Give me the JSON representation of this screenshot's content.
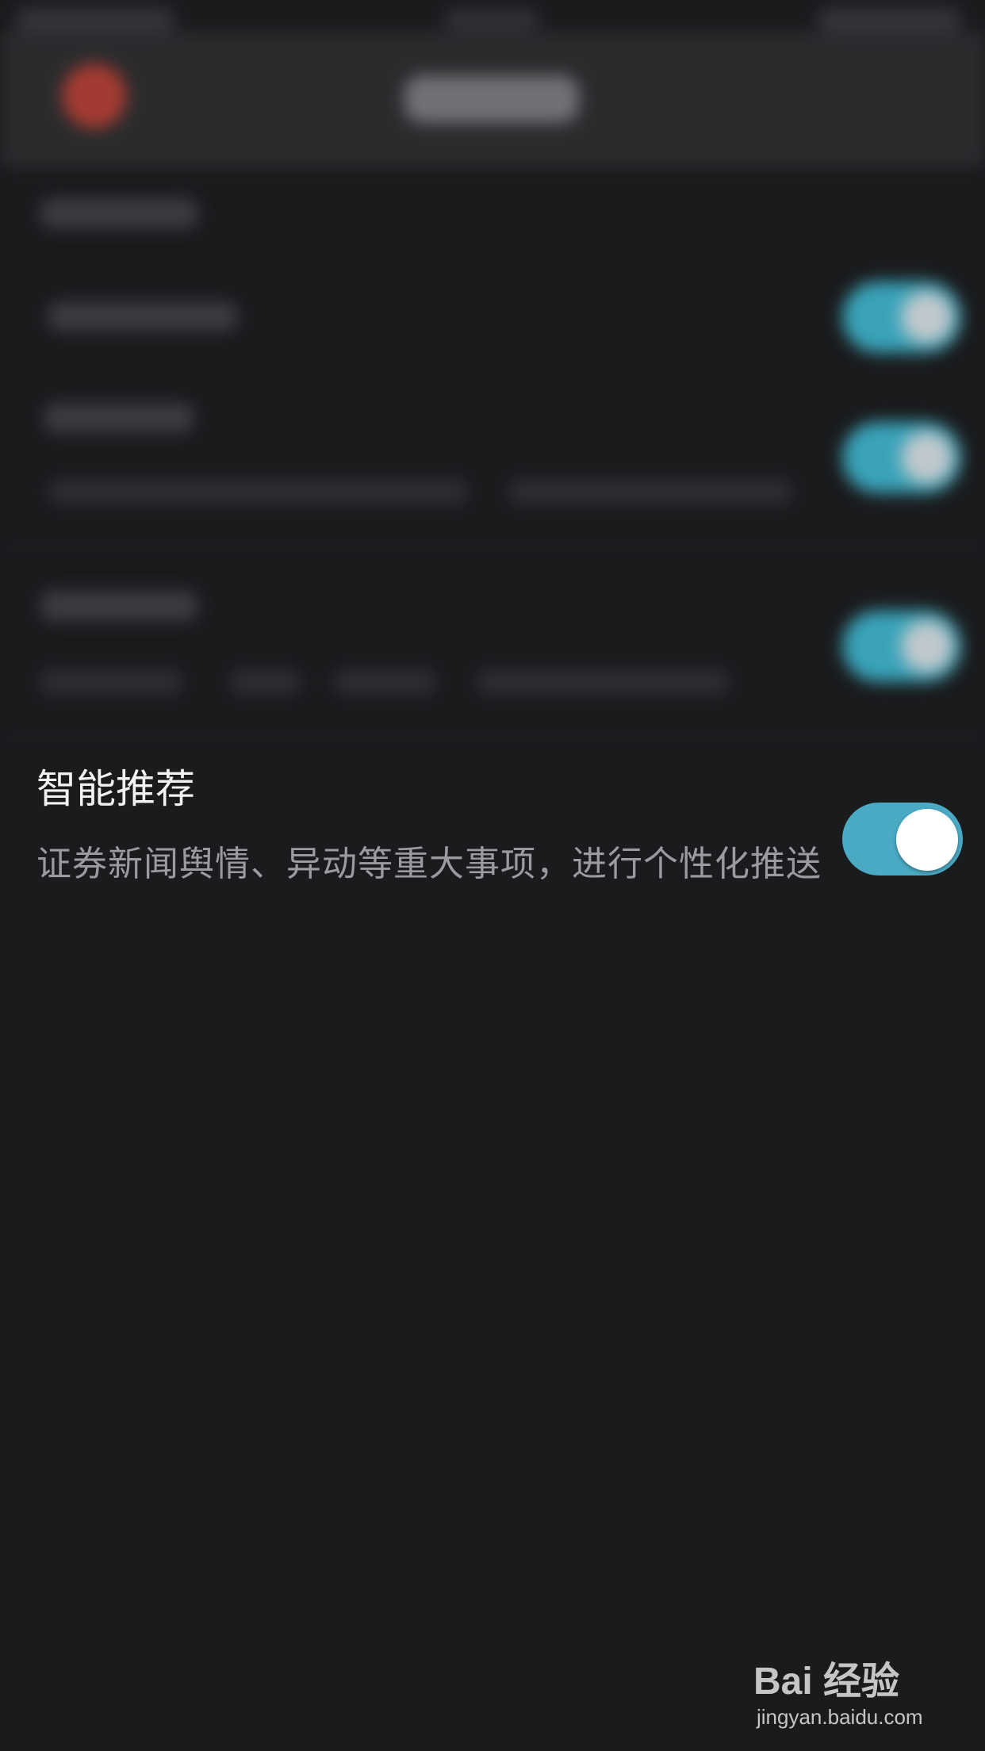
{
  "setting": {
    "title": "智能推荐",
    "description": "证券新闻舆情、异动等重大事项，进行个性化推送",
    "toggle_state": "on"
  },
  "colors": {
    "background": "#1a1b1d",
    "toggle_on": "#4aa9c3",
    "title_text": "#f2f2f2",
    "desc_text": "#9a9ba0"
  },
  "watermark": {
    "logo_text": "Bai 经验",
    "url": "jingyan.baidu.com"
  }
}
